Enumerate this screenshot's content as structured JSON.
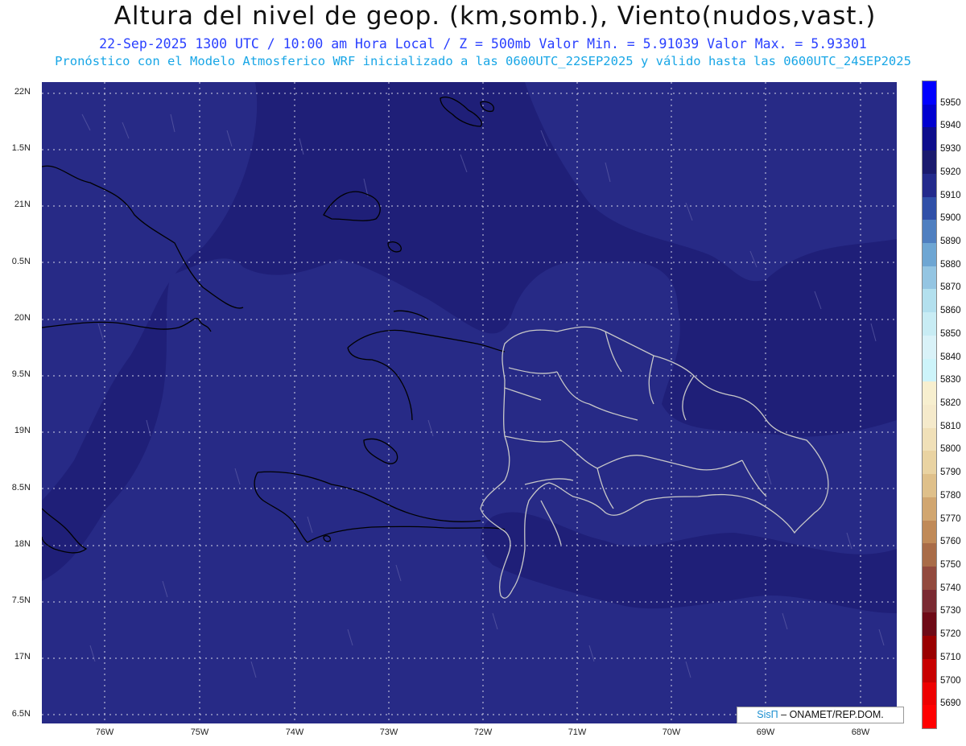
{
  "header": {
    "title": "Altura del nivel de geop. (km,somb.), Viento(nudos,vast.)",
    "subtitle_line1": "22-Sep-2025  1300 UTC / 10:00 am Hora Local / Z = 500mb   Valor Min. = 5.91039  Valor Max. = 5.93301",
    "subtitle_line2": "Pronóstico con el Modelo Atmosferico WRF inicializado a las 0600UTC_22SEP2025 y válido hasta las  0600UTC_24SEP2025"
  },
  "axes": {
    "lat_labels": [
      "22N",
      "1.5N",
      "21N",
      "0.5N",
      "20N",
      "9.5N",
      "19N",
      "8.5N",
      "18N",
      "7.5N",
      "17N",
      "6.5N"
    ],
    "lon_labels": [
      "76W",
      "75W",
      "74W",
      "73W",
      "72W",
      "71W",
      "70W",
      "69W",
      "68W"
    ]
  },
  "colorbar": {
    "levels": [
      "5950",
      "5940",
      "5930",
      "5920",
      "5910",
      "5900",
      "5890",
      "5880",
      "5870",
      "5860",
      "5850",
      "5840",
      "5830",
      "5820",
      "5810",
      "5800",
      "5790",
      "5780",
      "5770",
      "5760",
      "5750",
      "5740",
      "5730",
      "5720",
      "5710",
      "5700",
      "5690"
    ],
    "colors": [
      "#0000ff",
      "#0000d0",
      "#0d0d8c",
      "#1a1a6e",
      "#232a8c",
      "#3050a8",
      "#4f7fc0",
      "#6ea6d3",
      "#94c5e2",
      "#b3e0ee",
      "#c8ecf4",
      "#d9f2f8",
      "#cdf4fa",
      "#f7efcf",
      "#f5eacb",
      "#f0e0b8",
      "#e9d3a2",
      "#dfc08a",
      "#d1a670",
      "#c08a58",
      "#a96c48",
      "#924a3e",
      "#7a2a32",
      "#6e0a16",
      "#9a0000",
      "#c80000",
      "#ee0000",
      "#ff0000"
    ]
  },
  "map_colors": {
    "field_dark": "#1f1f78",
    "field_mid": "#272a86"
  },
  "credit": {
    "brand": "SisΠ",
    "text": "– ONAMET/REP.DOM."
  }
}
